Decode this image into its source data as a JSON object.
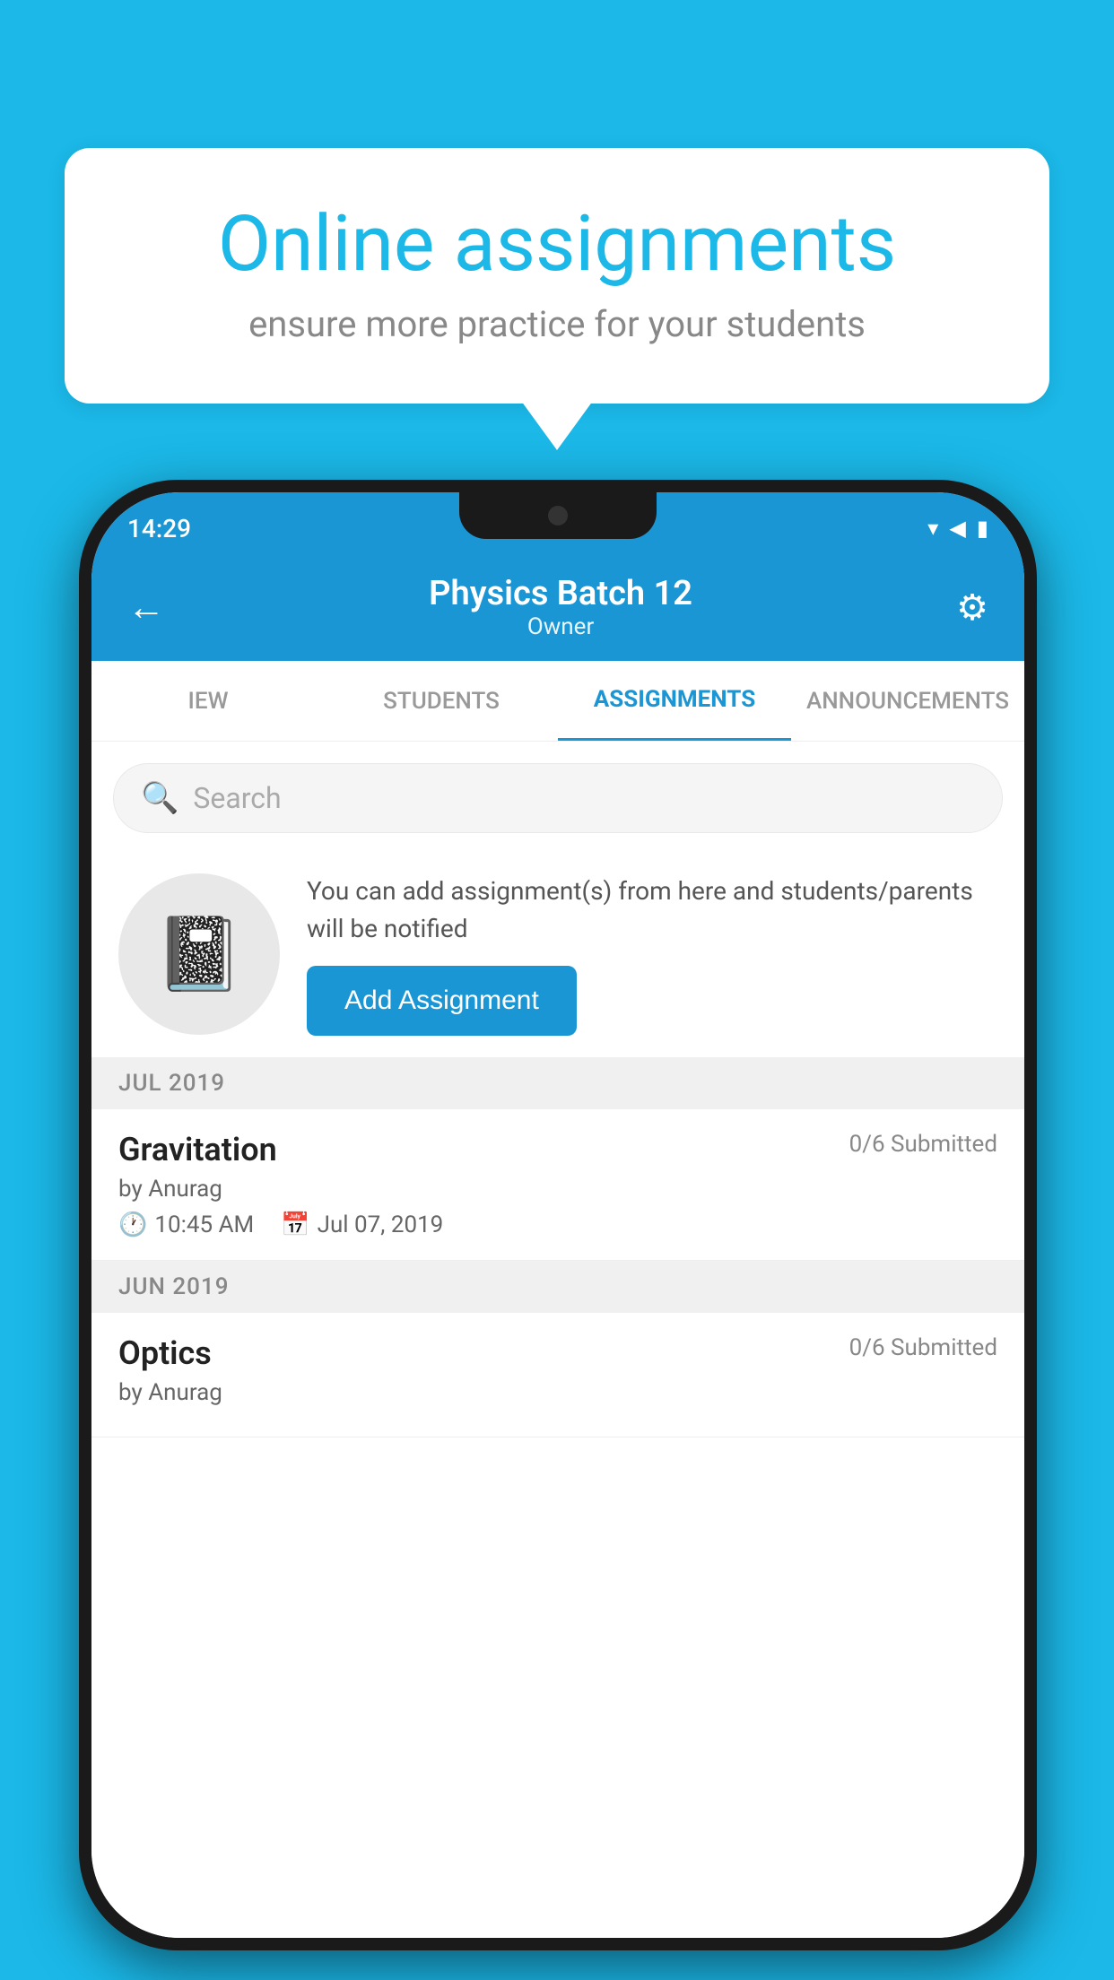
{
  "background_color": "#1BB8E8",
  "speech_bubble": {
    "title": "Online assignments",
    "subtitle": "ensure more practice for your students"
  },
  "status_bar": {
    "time": "14:29",
    "wifi": "▾",
    "signal": "▲",
    "battery": "▮"
  },
  "header": {
    "title": "Physics Batch 12",
    "subtitle": "Owner",
    "back_label": "←",
    "settings_label": "⚙"
  },
  "tabs": [
    {
      "label": "IEW",
      "active": false
    },
    {
      "label": "STUDENTS",
      "active": false
    },
    {
      "label": "ASSIGNMENTS",
      "active": true
    },
    {
      "label": "ANNOUNCEMENTS",
      "active": false
    }
  ],
  "search": {
    "placeholder": "Search"
  },
  "promo": {
    "description": "You can add assignment(s) from here and students/parents will be notified",
    "button_label": "Add Assignment"
  },
  "months": [
    {
      "label": "JUL 2019",
      "assignments": [
        {
          "title": "Gravitation",
          "submitted": "0/6 Submitted",
          "author": "by Anurag",
          "time": "10:45 AM",
          "date": "Jul 07, 2019"
        }
      ]
    },
    {
      "label": "JUN 2019",
      "assignments": [
        {
          "title": "Optics",
          "submitted": "0/6 Submitted",
          "author": "by Anurag",
          "time": "",
          "date": ""
        }
      ]
    }
  ]
}
